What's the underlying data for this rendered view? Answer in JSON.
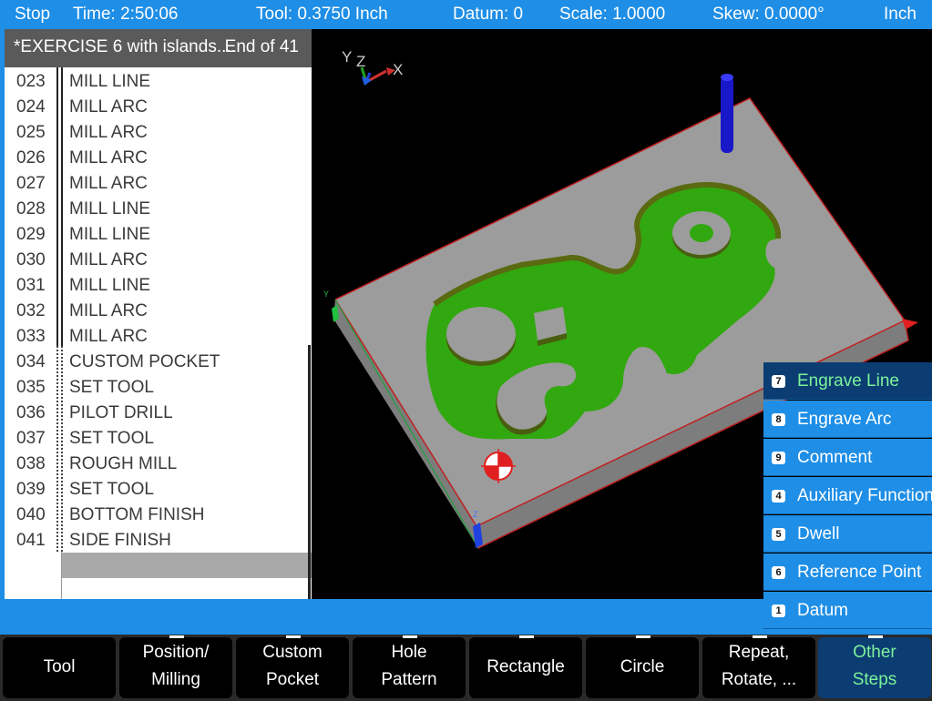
{
  "status": {
    "state": "Stop",
    "time": "Time: 2:50:06",
    "tool": "Tool: 0.3750 Inch",
    "datum": "Datum: 0",
    "scale": "Scale: 1.0000",
    "skew": "Skew: 0.0000°",
    "units": "Inch"
  },
  "program": {
    "title": "*EXERCISE 6 with islands....",
    "end_label": "End of 41",
    "rows": [
      {
        "num": "023",
        "text": "MILL LINE"
      },
      {
        "num": "024",
        "text": "MILL ARC"
      },
      {
        "num": "025",
        "text": "MILL ARC"
      },
      {
        "num": "026",
        "text": "MILL ARC"
      },
      {
        "num": "027",
        "text": "MILL ARC"
      },
      {
        "num": "028",
        "text": "MILL LINE"
      },
      {
        "num": "029",
        "text": "MILL LINE"
      },
      {
        "num": "030",
        "text": "MILL ARC"
      },
      {
        "num": "031",
        "text": "MILL LINE"
      },
      {
        "num": "032",
        "text": "MILL ARC"
      },
      {
        "num": "033",
        "text": "MILL ARC"
      },
      {
        "num": "034",
        "text": "CUSTOM POCKET"
      },
      {
        "num": "035",
        "text": "SET TOOL"
      },
      {
        "num": "036",
        "text": "PILOT DRILL"
      },
      {
        "num": "037",
        "text": "SET TOOL"
      },
      {
        "num": "038",
        "text": "ROUGH MILL"
      },
      {
        "num": "039",
        "text": "SET TOOL"
      },
      {
        "num": "040",
        "text": "BOTTOM FINISH"
      },
      {
        "num": "041",
        "text": "SIDE FINISH"
      }
    ]
  },
  "viewport": {
    "axis_labels": {
      "y": "Y",
      "z": "Z",
      "x": "X"
    },
    "corner_y_label": "Y",
    "corner_z_label": "Z",
    "colors": {
      "stock": "#9a9a9a",
      "pocket": "#31a80f",
      "tool": "#1818c8",
      "edge": "#c02020"
    }
  },
  "popup_menu": {
    "items": [
      {
        "key": "7",
        "label": "Engrave Line",
        "active": true
      },
      {
        "key": "8",
        "label": "Engrave Arc",
        "active": false
      },
      {
        "key": "9",
        "label": "Comment",
        "active": false
      },
      {
        "key": "4",
        "label": "Auxiliary Function",
        "active": false
      },
      {
        "key": "5",
        "label": "Dwell",
        "active": false
      },
      {
        "key": "6",
        "label": "Reference Point",
        "active": false
      },
      {
        "key": "1",
        "label": "Datum",
        "active": false
      }
    ]
  },
  "softkeys": [
    {
      "line1": "Tool",
      "line2": ""
    },
    {
      "line1": "Position/",
      "line2": "Milling"
    },
    {
      "line1": "Custom",
      "line2": "Pocket"
    },
    {
      "line1": "Hole",
      "line2": "Pattern"
    },
    {
      "line1": "Rectangle",
      "line2": ""
    },
    {
      "line1": "Circle",
      "line2": ""
    },
    {
      "line1": "Repeat,",
      "line2": "Rotate, ..."
    },
    {
      "line1": "Other",
      "line2": "Steps"
    }
  ],
  "accent_colors": {
    "bar_blue": "#1e8ee6",
    "active_dark": "#0b3d73",
    "active_text": "#7cf29a"
  }
}
